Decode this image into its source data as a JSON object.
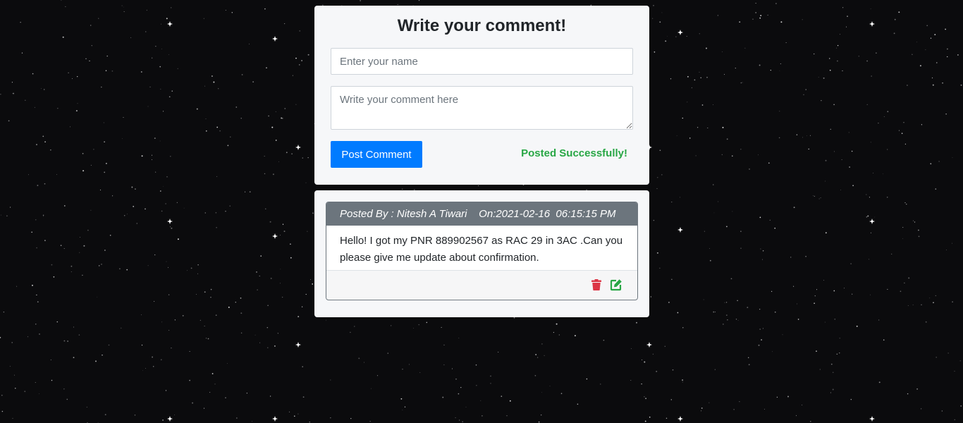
{
  "form": {
    "title": "Write your comment!",
    "name_placeholder": "Enter your name",
    "name_value": "",
    "comment_placeholder": "Write your comment here",
    "comment_value": "",
    "post_button_label": "Post Comment",
    "status_message": "Posted Successfully!"
  },
  "comments": [
    {
      "header": "Posted By : Nitesh A Tiwari    On:2021-02-16  06:15:15 PM",
      "body": "Hello! I got my PNR 889902567 as RAC 29 in 3AC .Can you please give me update about confirmation.",
      "actions": [
        {
          "icon": "trash-icon",
          "color": "#dc3545"
        },
        {
          "icon": "edit-icon",
          "color": "#28a745"
        }
      ]
    }
  ],
  "colors": {
    "background": "#0b0b0d",
    "card": "#f6f7f9",
    "primary": "#007bff",
    "success": "#28a745",
    "danger": "#dc3545",
    "comment_header": "#6c757d"
  }
}
